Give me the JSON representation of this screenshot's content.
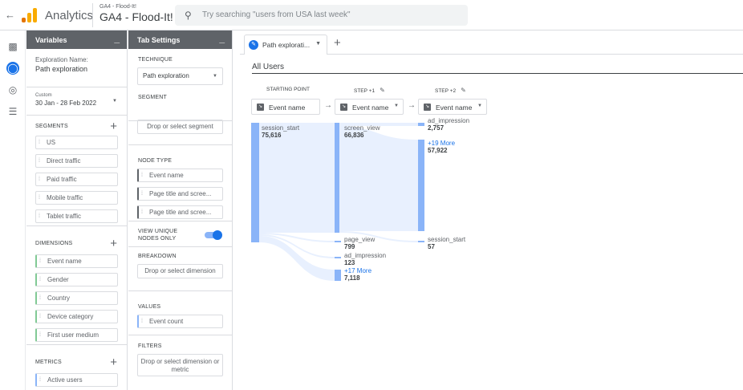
{
  "header": {
    "back_icon": "arrow-left-icon",
    "app_name": "Analytics",
    "property_small": "GA4 - Flood-It!",
    "property_name": "GA4 - Flood-It!",
    "search_placeholder": "Try searching \"users from USA last week\"",
    "colors": {
      "logo_orange": "#f9ab00",
      "logo_dark": "#e37400"
    }
  },
  "rail": {
    "icons": [
      "bar-chart-icon",
      "explore-icon",
      "advertising-icon",
      "list-icon"
    ]
  },
  "variables": {
    "title": "Variables",
    "exploration_label": "Exploration Name:",
    "exploration_name": "Path exploration",
    "date_custom": "Custom",
    "date_range": "30 Jan - 28 Feb 2022",
    "segments_label": "SEGMENTS",
    "segments": [
      "US",
      "Direct traffic",
      "Paid traffic",
      "Mobile traffic",
      "Tablet traffic"
    ],
    "dimensions_label": "DIMENSIONS",
    "dimensions": [
      "Event name",
      "Gender",
      "Country",
      "Device category",
      "First user medium"
    ],
    "metrics_label": "METRICS",
    "metrics": [
      "Active users"
    ]
  },
  "tab_settings": {
    "title": "Tab Settings",
    "technique_label": "TECHNIQUE",
    "technique_value": "Path exploration",
    "segment_label": "SEGMENT",
    "segment_drop": "Drop or select segment",
    "node_type_label": "NODE TYPE",
    "node_types": [
      "Event name",
      "Page title and scree...",
      "Page title and scree..."
    ],
    "unique_nodes_label": "VIEW UNIQUE NODES ONLY",
    "breakdown_label": "BREAKDOWN",
    "breakdown_drop": "Drop or select dimension",
    "values_label": "VALUES",
    "values_item": "Event count",
    "filters_label": "FILTERS",
    "filters_drop": "Drop or select dimension or metric"
  },
  "main": {
    "tab_label": "Path explorati...",
    "segment_title": "All Users",
    "starting_point": "STARTING POINT",
    "step1": "STEP +1",
    "step2": "STEP +2",
    "node_select": "Event name",
    "colors": {
      "node": "#8ab4f8",
      "flow": "#e8f0fe",
      "accent": "#1a73e8"
    }
  },
  "chart_data": {
    "type": "sankey",
    "columns": [
      {
        "label": "STARTING POINT",
        "nodes": [
          {
            "name": "session_start",
            "value": "75,616"
          }
        ]
      },
      {
        "label": "STEP +1",
        "nodes": [
          {
            "name": "screen_view",
            "value": "66,836"
          },
          {
            "name": "page_view",
            "value": "799"
          },
          {
            "name": "ad_impression",
            "value": "123"
          },
          {
            "name": "+17 More",
            "value": "7,118"
          }
        ]
      },
      {
        "label": "STEP +2",
        "nodes": [
          {
            "name": "ad_impression",
            "value": "2,757"
          },
          {
            "name": "+19 More",
            "value": "57,922"
          },
          {
            "name": "session_start",
            "value": "57"
          }
        ]
      }
    ]
  }
}
